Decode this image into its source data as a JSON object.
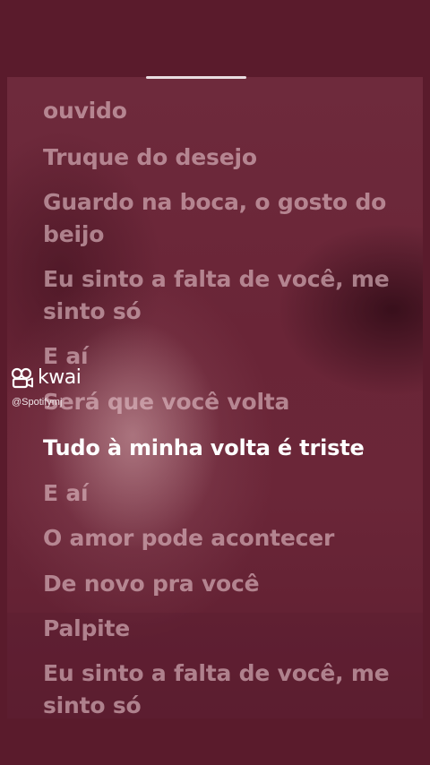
{
  "lyrics": {
    "lines": [
      "ouvido",
      "Truque do desejo",
      "Guardo na boca, o gosto do beijo",
      "Eu sinto a falta de você, me sinto só",
      "E aí",
      "Será que você volta",
      "Tudo à minha volta é triste",
      "E aí",
      "O amor pode acontecer",
      "De novo pra você",
      "Palpite",
      "Eu sinto a falta de você, me sinto só"
    ],
    "active_index": 6
  },
  "watermark": {
    "brand": "kwai",
    "handle": "@Spotifymj",
    "icon": "kwai-logo-icon"
  },
  "colors": {
    "background": "#5a1b2c",
    "lyric_inactive": "#e2bec6",
    "lyric_active": "#ffffff"
  }
}
